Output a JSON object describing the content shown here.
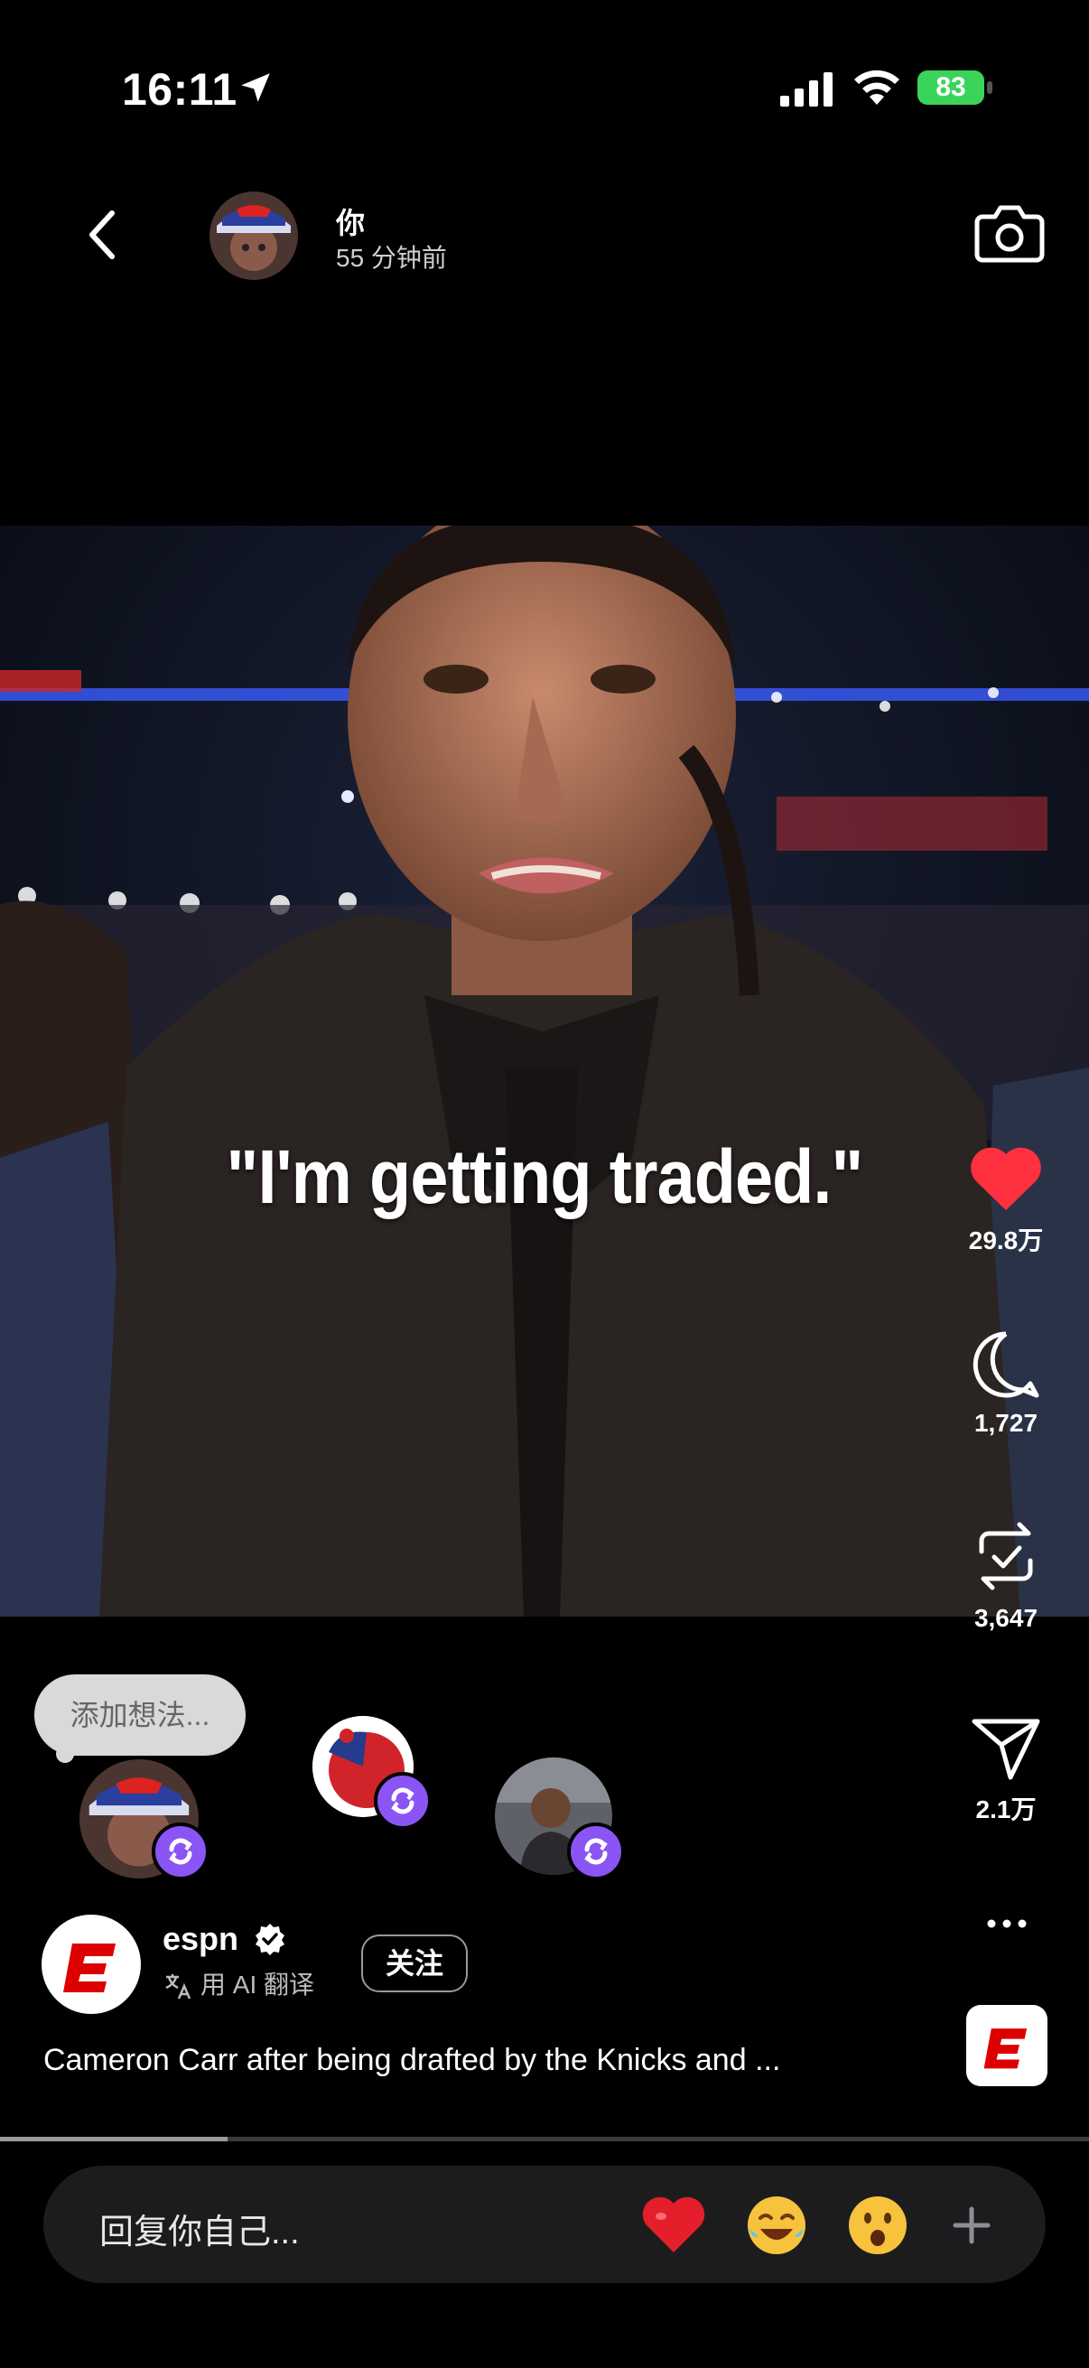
{
  "status_bar": {
    "time": "16:11",
    "battery": "83"
  },
  "header": {
    "username": "你",
    "time_ago": "55 分钟前"
  },
  "video": {
    "caption": "\"I'm getting traded.\""
  },
  "actions": {
    "likes": "29.8万",
    "comments": "1,727",
    "reposts": "3,647",
    "shares": "2.1万"
  },
  "thought_bubble": "添加想法...",
  "account": {
    "name": "espn",
    "translate": "用 AI 翻译",
    "follow": "关注",
    "description": "Cameron Carr after being drafted by the Knicks and ..."
  },
  "reply": {
    "placeholder": "回复你自己..."
  },
  "colors": {
    "like_red": "#ff3040",
    "repost_purple": "#8a55f4",
    "espn_red": "#d00"
  }
}
